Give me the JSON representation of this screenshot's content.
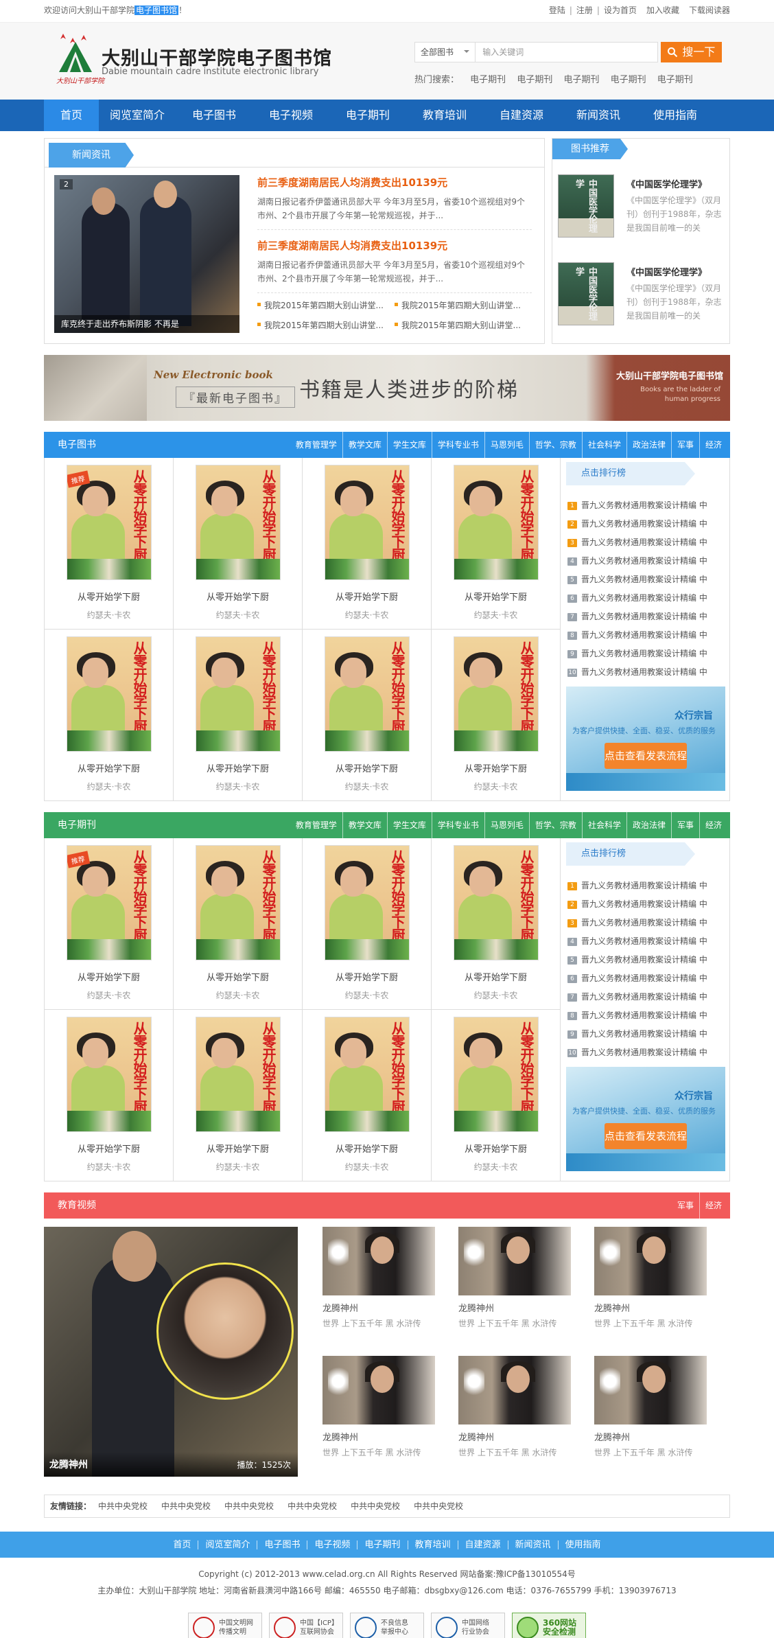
{
  "topbar": {
    "welcome": "欢迎访问大别山干部学院",
    "highlight": "电子图书馆",
    "excl": "！",
    "links": [
      "登陆",
      "注册",
      "设为首页",
      "加入收藏",
      "下载阅读器"
    ]
  },
  "header": {
    "logo_name": "大别山干部学院电子图书馆",
    "logo_en": "Dabie mountain cadre institute electronic library",
    "search": {
      "select": "全部图书",
      "placeholder": "输入关键词",
      "button": "搜一下"
    },
    "hot_label": "热门搜索：",
    "hot": [
      "电子期刊",
      "电子期刊",
      "电子期刊",
      "电子期刊",
      "电子期刊"
    ]
  },
  "nav": [
    "首页",
    "阅览室简介",
    "电子图书",
    "电子视频",
    "电子期刊",
    "教育培训",
    "自建资源",
    "新闻资讯",
    "使用指南"
  ],
  "news": {
    "tab": "新闻资讯",
    "pic_num": "2",
    "pic_caption": "库克终于走出乔布斯阴影 不再是",
    "items": [
      {
        "title": "前三季度湖南居民人均消费支出10139元",
        "desc": "湖南日报记者乔伊蕾通讯员部大平 今年3月至5月，省委10个巡视组对9个市州、2个县市开展了今年第一轮常规巡视，并于..."
      },
      {
        "title": "前三季度湖南居民人均消费支出10139元",
        "desc": "湖南日报记者乔伊蕾通讯员部大平 今年3月至5月，省委10个巡视组对9个市州、2个县市开展了今年第一轮常规巡视，并于..."
      }
    ],
    "list": [
      "我院2015年第四期大别山讲堂...",
      "我院2015年第四期大别山讲堂...",
      "我院2015年第四期大别山讲堂...",
      "我院2015年第四期大别山讲堂..."
    ]
  },
  "recommend": {
    "tab": "图书推荐",
    "items": [
      {
        "cover": "中国医学伦理学",
        "title": "《中国医学伦理学》",
        "desc": "《中国医学伦理学》（双月刊）创刊于1988年，杂志是我国目前唯一的关"
      },
      {
        "cover": "中国医学伦理学",
        "title": "《中国医学伦理学》",
        "desc": "《中国医学伦理学》（双月刊）创刊于1988年，杂志是我国目前唯一的关"
      }
    ]
  },
  "banner": {
    "en": "New Electronic book",
    "zh": "『最新电子图书』",
    "main": "书籍是人类进步的阶梯",
    "right_title": "大别山干部学院电子图书馆",
    "right_sub": "Books are the ladder of human progress"
  },
  "categories": [
    "教育管理学",
    "教学文库",
    "学生文库",
    "学科专业书",
    "马恩列毛",
    "哲学、宗教",
    "社会科学",
    "政治法律",
    "军事",
    "经济"
  ],
  "book_cover": {
    "title": "从零开始学下厨",
    "badge": "推荐"
  },
  "books": [
    {
      "title": "从零开始学下厨",
      "author": "约瑟夫·卡农"
    },
    {
      "title": "从零开始学下厨",
      "author": "约瑟夫·卡农"
    },
    {
      "title": "从零开始学下厨",
      "author": "约瑟夫·卡农"
    },
    {
      "title": "从零开始学下厨",
      "author": "约瑟夫·卡农"
    },
    {
      "title": "从零开始学下厨",
      "author": "约瑟夫·卡农"
    },
    {
      "title": "从零开始学下厨",
      "author": "约瑟夫·卡农"
    },
    {
      "title": "从零开始学下厨",
      "author": "约瑟夫·卡农"
    },
    {
      "title": "从零开始学下厨",
      "author": "约瑟夫·卡农"
    }
  ],
  "rank": {
    "title": "点击排行榜",
    "items": [
      "晋九义务教材通用教案设计精编 中",
      "晋九义务教材通用教案设计精编 中",
      "晋九义务教材通用教案设计精编 中",
      "晋九义务教材通用教案设计精编 中",
      "晋九义务教材通用教案设计精编 中",
      "晋九义务教材通用教案设计精编 中",
      "晋九义务教材通用教案设计精编 中",
      "晋九义务教材通用教案设计精编 中",
      "晋九义务教材通用教案设计精编 中",
      "晋九义务教材通用教案设计精编 中"
    ]
  },
  "ad": {
    "title": "众行宗旨",
    "sub": "为客户提供快捷、全面、稳妥、优质的服务",
    "button": "点击查看发表流程"
  },
  "sections": {
    "ebook": "电子图书",
    "journal": "电子期刊",
    "video": "教育视频"
  },
  "video_cats": [
    "军事",
    "经济"
  ],
  "video": {
    "big_title": "龙腾神州",
    "big_plays": "播放：1525次",
    "items": [
      {
        "title": "龙腾神州",
        "desc": "世界 上下五千年 黑 水浒传"
      },
      {
        "title": "龙腾神州",
        "desc": "世界 上下五千年 黑 水浒传"
      },
      {
        "title": "龙腾神州",
        "desc": "世界 上下五千年 黑 水浒传"
      },
      {
        "title": "龙腾神州",
        "desc": "世界 上下五千年 黑 水浒传"
      },
      {
        "title": "龙腾神州",
        "desc": "世界 上下五千年 黑 水浒传"
      },
      {
        "title": "龙腾神州",
        "desc": "世界 上下五千年 黑 水浒传"
      }
    ]
  },
  "friends": {
    "label": "友情链接：",
    "links": [
      "中共中央党校",
      "中共中央党校",
      "中共中央党校",
      "中共中央党校",
      "中共中央党校",
      "中共中央党校"
    ]
  },
  "footer": {
    "nav": [
      "首页",
      "阅览室简介",
      "电子图书",
      "电子视频",
      "电子期刊",
      "教育培训",
      "自建资源",
      "新闻资讯",
      "使用指南"
    ],
    "copyright": "Copyright (c) 2012-2013 www.celad.org.cn All Rights Reserved 网站备案:豫ICP备13010554号",
    "address": "主办单位：大别山干部学院 地址：河南省新县潢河中路166号 邮编：465550 电子邮箱：dbsgbxy@126.com 电话：0376-7655799 手机：13903976713",
    "badges": [
      {
        "a": "中国文明网",
        "b": "传播文明"
      },
      {
        "a": "中国【ICP】",
        "b": "互联网协会"
      },
      {
        "a": "不良信息",
        "b": "举报中心"
      },
      {
        "a": "中国网络",
        "b": "行业协会"
      },
      {
        "a": "360网站",
        "b": "安全检测"
      }
    ]
  },
  "colors": {
    "nav": "#1b66b7",
    "nav_active": "#2b8ae6",
    "accent": "#f37b18",
    "news_title": "#e85f11",
    "ebook_bar": "#2c93e8",
    "journal_bar": "#3aa762",
    "video_bar": "#f25a5a",
    "footer_nav": "#3fa0e8"
  }
}
